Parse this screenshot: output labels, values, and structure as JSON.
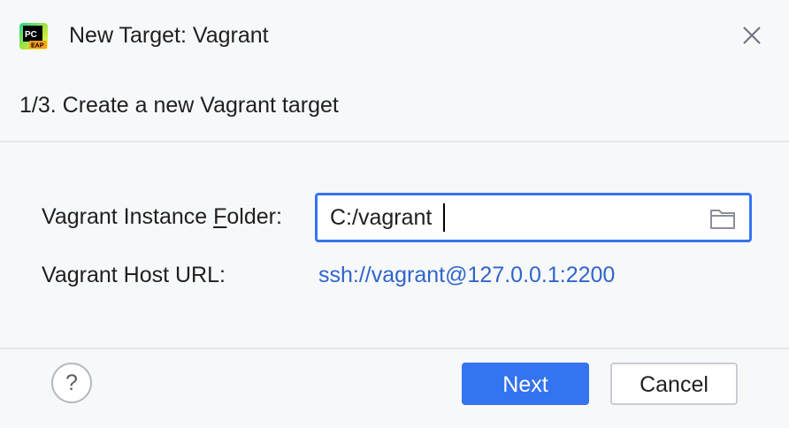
{
  "window": {
    "title": "New Target: Vagrant",
    "app_icon": {
      "name": "pycharm-eap-icon",
      "text_top": "PC",
      "text_bottom": "EAP"
    },
    "close_icon": "close-icon"
  },
  "step": {
    "header": "1/3. Create a new Vagrant target"
  },
  "form": {
    "folder_label_before": "Vagrant Instance ",
    "folder_label_mnemonic": "F",
    "folder_label_after": "older:",
    "folder_value": "C:/vagrant",
    "folder_browse_icon": "folder-icon",
    "host_label": "Vagrant Host URL:",
    "host_value": "ssh://vagrant@127.0.0.1:2200"
  },
  "footer": {
    "help_label": "?",
    "next_label": "Next",
    "cancel_label": "Cancel"
  },
  "colors": {
    "accent": "#3574f0",
    "link": "#2f65ca",
    "background": "#f7f8fa"
  }
}
